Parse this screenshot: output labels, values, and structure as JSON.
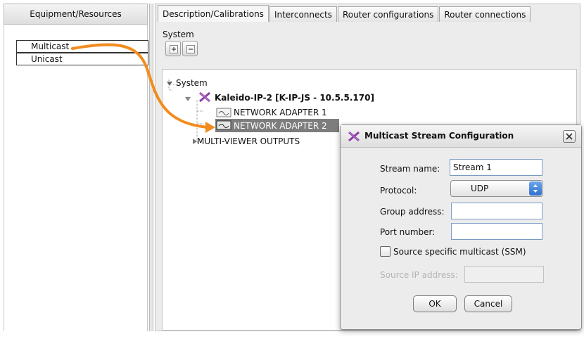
{
  "left_panel": {
    "header": "Equipment/Resources",
    "items": [
      {
        "label": "Multicast"
      },
      {
        "label": "Unicast"
      }
    ]
  },
  "tabs": [
    {
      "label": "Description/Calibrations",
      "active": true
    },
    {
      "label": "Interconnects"
    },
    {
      "label": "Router configurations"
    },
    {
      "label": "Router connections"
    }
  ],
  "system_section": {
    "label": "System",
    "icons": [
      "expand-icon",
      "collapse-icon"
    ]
  },
  "tree": {
    "root": "System",
    "device": "Kaleido-IP-2 [K-IP-JS - 10.5.5.170]",
    "adapter1": "NETWORK ADAPTER 1",
    "adapter2": "NETWORK ADAPTER 2",
    "outputs": "MULTI-VIEWER OUTPUTS"
  },
  "dialog": {
    "title": "Multicast Stream Configuration",
    "stream_name_label": "Stream name:",
    "stream_name_value": "Stream 1",
    "protocol_label": "Protocol:",
    "protocol_value": "UDP",
    "group_address_label": "Group address:",
    "group_address_value": "",
    "port_number_label": "Port number:",
    "port_number_value": "",
    "ssm_label": "Source specific multicast (SSM)",
    "ssm_checked": false,
    "source_ip_label": "Source IP address:",
    "source_ip_value": "",
    "ok_label": "OK",
    "cancel_label": "Cancel"
  },
  "colors": {
    "drag_arrow": "#f28c1e",
    "selection": "#7d7d7d",
    "device_icon": "#8b3fa3",
    "field_border": "#7a9cc4"
  }
}
